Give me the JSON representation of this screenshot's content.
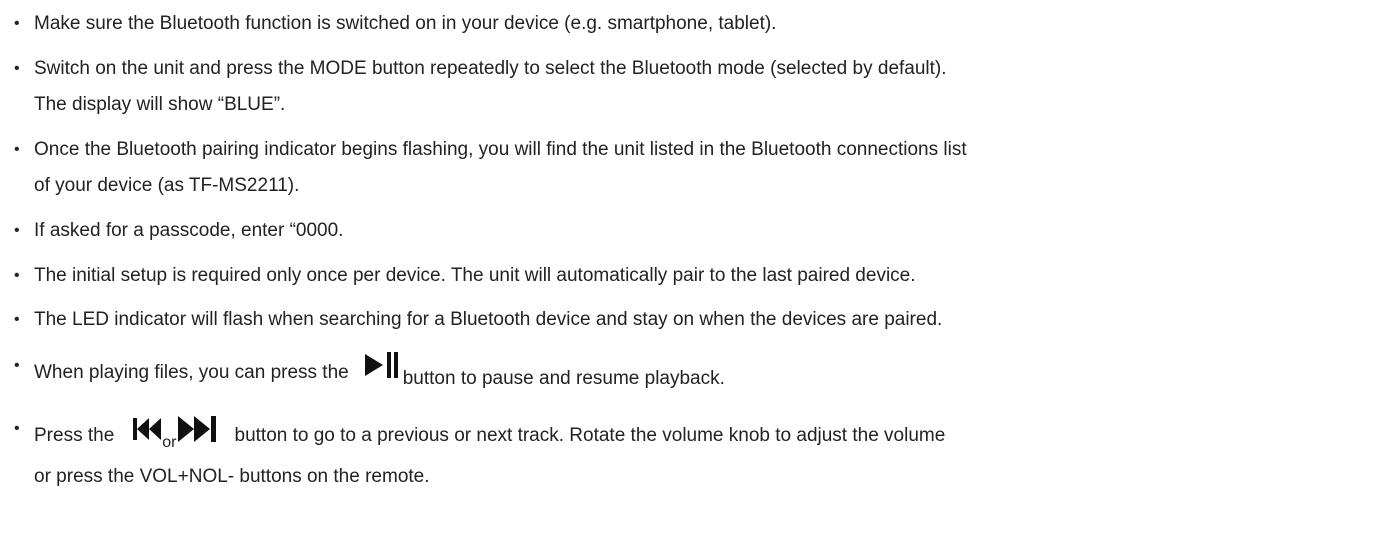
{
  "bullet": "•",
  "items": [
    {
      "text": "Make sure the Bluetooth function is switched on in your device (e.g. smartphone, tablet)."
    },
    {
      "line1": "Switch on the unit and press the MODE button repeatedly to select the Bluetooth mode (selected by default).",
      "line2": "The display will show “BLUE”."
    },
    {
      "line1": "Once the Bluetooth pairing indicator begins flashing, you will find the unit listed in the Bluetooth connections list",
      "line2": "of your device (as TF-MS2211)."
    },
    {
      "text": "If asked for a passcode, enter “0000."
    },
    {
      "text": "The initial setup is required only once per device. The unit will automatically pair to the last paired device."
    },
    {
      "text": "The LED indicator will flash when searching for a Bluetooth device and stay on when the devices are paired."
    },
    {
      "before": "When playing files, you can press the",
      "after": "button to pause and resume playback.",
      "icon": "play-pause-icon"
    },
    {
      "before": "Press the",
      "or": "or",
      "after": "button to go to a previous or next track. Rotate the volume knob to adjust the volume",
      "line2": "or press the VOL+NOL- buttons on the remote.",
      "icons": [
        "prev-track-icon",
        "next-track-icon"
      ]
    }
  ],
  "colors": {
    "text": "#222222",
    "icon": "#111111",
    "background": "#ffffff"
  }
}
